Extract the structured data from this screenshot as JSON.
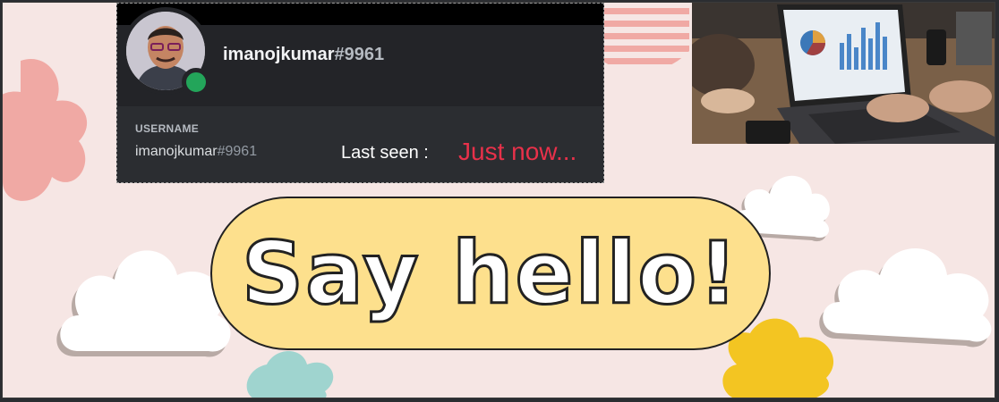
{
  "profile": {
    "username": "imanojkumar",
    "discriminator": "#9961",
    "section_label": "USERNAME",
    "status_color": "#23a55a"
  },
  "last_seen": {
    "label": "Last seen :",
    "value": "Just now..."
  },
  "banner": {
    "headline": "Say hello!",
    "pill_color": "#fde08d",
    "background_color": "#f6e6e4"
  },
  "icons": [
    "avatar-photo",
    "online-status-dot",
    "laptop-chart-photo",
    "cloud-decoration",
    "blob-decoration"
  ]
}
